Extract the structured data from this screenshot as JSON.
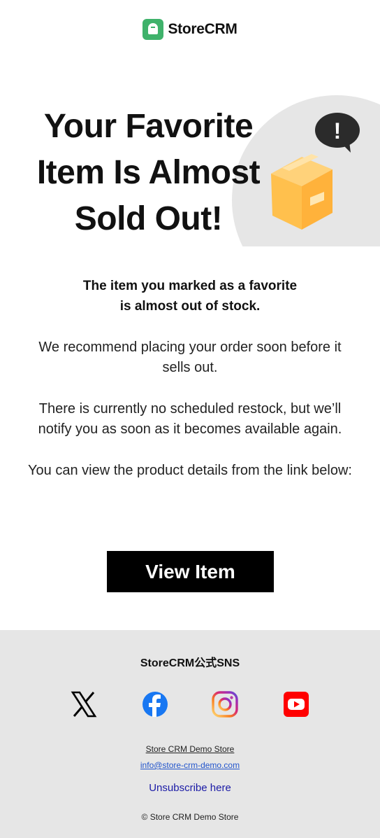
{
  "header": {
    "brand": "StoreCRM",
    "logo_icon": "ghost-logo-icon",
    "brand_color": "#3fb26b"
  },
  "hero": {
    "title_line1": "Your Favorite",
    "title_line2": "Item Is Almost",
    "title_line3": "Sold Out!",
    "bubble_icon": "exclamation-bubble-icon",
    "box_icon": "package-box-icon",
    "bubble_mark": "!"
  },
  "body": {
    "lead_line1": "The item you marked as a favorite",
    "lead_line2": "is almost out of stock.",
    "para1": "We recommend placing your order soon before it sells out.",
    "para2": "There is currently no scheduled restock, but we’ll notify you as soon as it becomes available again.",
    "para3": "You can view the product details from the link below:"
  },
  "cta": {
    "label": "View Item"
  },
  "footer": {
    "sns_title": "StoreCRM公式SNS",
    "sns": [
      {
        "name": "x-icon",
        "color": "#000000"
      },
      {
        "name": "facebook-icon",
        "color": "#1877f2"
      },
      {
        "name": "instagram-icon",
        "color": "#e1306c"
      },
      {
        "name": "youtube-icon",
        "color": "#ff0000"
      }
    ],
    "store_name": "Store CRM Demo Store",
    "email": "info@store-crm-demo.com",
    "unsubscribe": "Unsubscribe here",
    "copyright": "© Store CRM Demo Store"
  }
}
